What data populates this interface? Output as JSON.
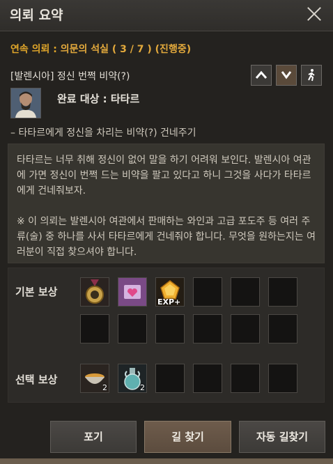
{
  "window": {
    "title": "의뢰 요약"
  },
  "series": {
    "label": "연속 의뢰 : ",
    "name": "의문의 석실 ( 3 / 7 ) (진행중)"
  },
  "quest": {
    "title": "[발렌시아] 정신 번쩍 비약(?)",
    "target_label": "완료 대상 : 타타르",
    "objective": "– 타타르에게 정신을 차리는 비약(?) 건네주기",
    "description": [
      "타타르는 너무 취해 정신이 없어 말을 하기 어려워 보인다. 발렌시아 여관에 가면 정신이 번쩍 드는 비약을 팔고 있다고 하니 그것을 사다가 타타르에게 건네줘보자.",
      "※ 이 의뢰는 발렌시아 여관에서 판매하는 와인과 고급 포도주 등 여러 주류(술) 중 하나를 사서 타타르에게 건네줘야 합니다. 무엇을 원하는지는 여러분이 직접 찾으셔야 합니다."
    ]
  },
  "rewards": {
    "basic_label": "기본 보상",
    "choice_label": "선택 보상",
    "basic_items": [
      {
        "icon": "medal-icon"
      },
      {
        "icon": "heart-scroll-icon"
      },
      {
        "icon": "exp-gem-icon",
        "label": "EXP+"
      }
    ],
    "choice_items": [
      {
        "icon": "soup-bowl-icon",
        "count": "2"
      },
      {
        "icon": "potion-flask-icon",
        "count": "2"
      }
    ]
  },
  "buttons": {
    "abandon": "포기",
    "navigate": "길 찾기",
    "auto_navigate": "자동 길찾기"
  },
  "colors": {
    "accent": "#e0a62a",
    "panel": "#24221f",
    "description_bg": "#37352f"
  }
}
